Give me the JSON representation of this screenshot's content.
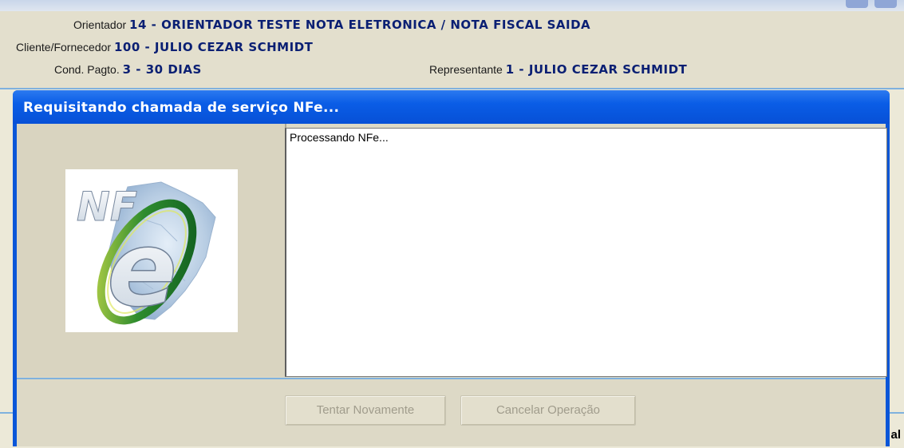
{
  "header": {
    "orientador_label": "Orientador",
    "orientador_value": "14 - ORIENTADOR TESTE NOTA ELETRONICA / NOTA FISCAL SAIDA",
    "cliente_label": "Cliente/Fornecedor",
    "cliente_value": "100 - JULIO CEZAR SCHMIDT",
    "cond_label": "Cond. Pagto.",
    "cond_value": "3 - 30 DIAS",
    "representante_label": "Representante",
    "representante_value": "1 - JULIO CEZAR SCHMIDT"
  },
  "dialog": {
    "title": "Requisitando chamada de serviço NFe...",
    "logo_text": "NF",
    "logo_letter": "e",
    "log_text": "Processando NFe...",
    "retry_button": "Tentar Novamente",
    "cancel_button": "Cancelar Operação"
  },
  "background": {
    "cutoff_text": "al"
  },
  "colors": {
    "title_blue": "#0a5de6",
    "value_navy": "#0a1f73",
    "disabled_text": "#a09c8c"
  }
}
